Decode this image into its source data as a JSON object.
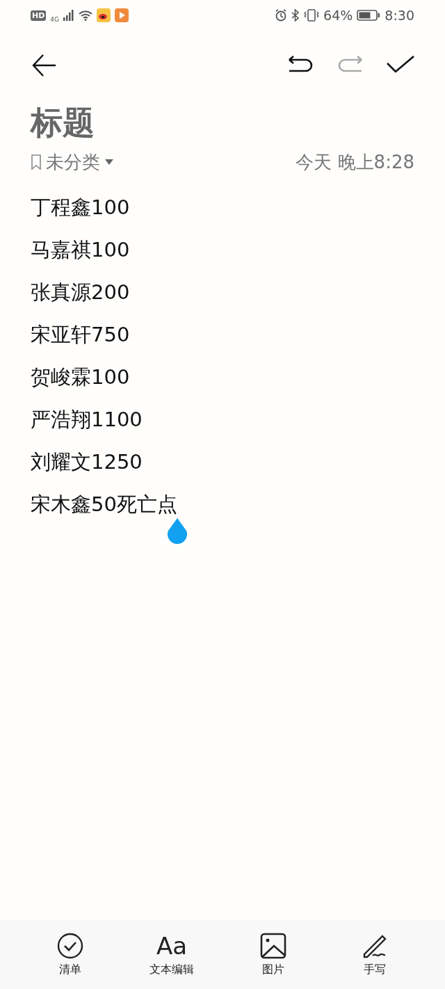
{
  "status_bar": {
    "hd": "HD",
    "network": "4G",
    "battery_percent": "64%",
    "time": "8:30"
  },
  "toolbar": {
    "undo": {
      "disabled": false
    },
    "redo": {
      "disabled": true
    }
  },
  "note": {
    "title": "标题",
    "category": "未分类",
    "timestamp": "今天 晚上8:28",
    "lines": [
      "丁程鑫100",
      "马嘉祺100",
      "张真源200",
      "宋亚轩750",
      "贺峻霖100",
      "严浩翔1100",
      "刘耀文1250",
      "宋木鑫50死亡点"
    ]
  },
  "bottom_bar": [
    {
      "kind": "checklist",
      "label": "清单"
    },
    {
      "kind": "text",
      "glyph": "Aa",
      "label": "文本编辑"
    },
    {
      "kind": "image",
      "label": "图片"
    },
    {
      "kind": "handwriting",
      "label": "手写"
    }
  ]
}
